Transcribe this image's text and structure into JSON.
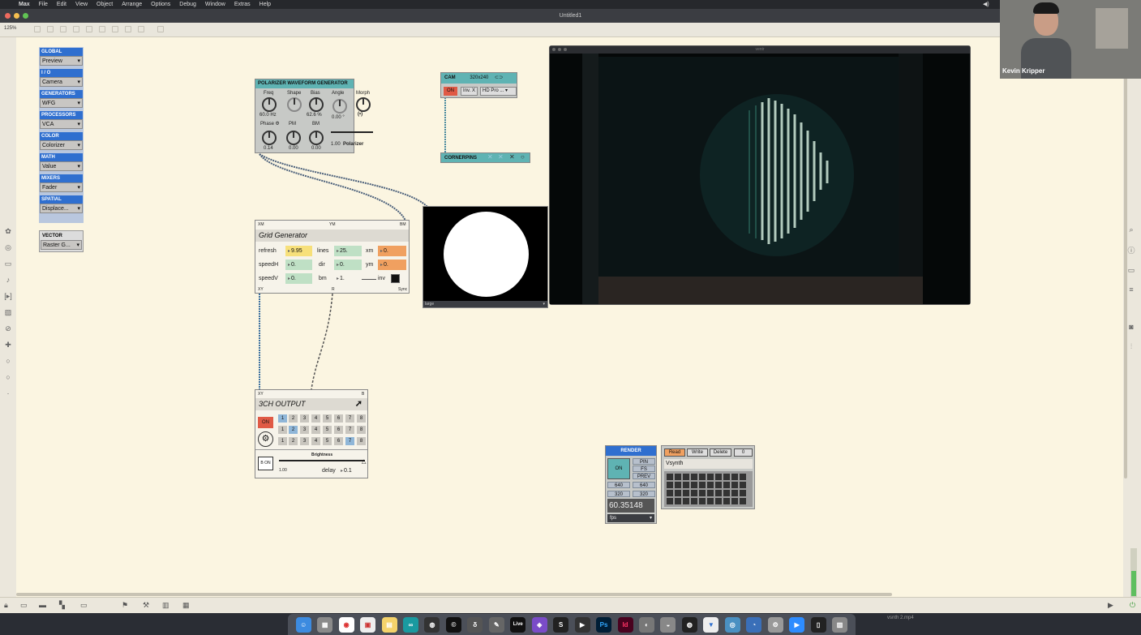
{
  "menubar": {
    "apple": "",
    "items": [
      "Max",
      "File",
      "Edit",
      "View",
      "Object",
      "Arrange",
      "Options",
      "Debug",
      "Window",
      "Extras",
      "Help"
    ]
  },
  "window": {
    "title": "Untitled1",
    "zoom": "125%"
  },
  "categories": [
    {
      "header": "GLOBAL",
      "value": "Preview"
    },
    {
      "header": "I / O",
      "value": "Camera"
    },
    {
      "header": "GENERATORS",
      "value": "WFG"
    },
    {
      "header": "PROCESSORS",
      "value": "VCA"
    },
    {
      "header": "COLOR",
      "value": "Colorizer"
    },
    {
      "header": "MATH",
      "value": "Value"
    },
    {
      "header": "MIXERS",
      "value": "Fader"
    },
    {
      "header": "SPATIAL",
      "value": "Displace..."
    }
  ],
  "vector": {
    "header": "VECTOR",
    "value": "Raster G..."
  },
  "wfg": {
    "title": "POLARIZER WAVEFORM GENERATOR",
    "freq_label": "Freq",
    "freq_value": "60.0 Hz",
    "shape_label": "Shape",
    "bias_label": "Bias",
    "bias_value": "62.6 %",
    "angle_label": "Angle",
    "angle_value": "0.00 °",
    "morph_label": "Morph",
    "morph_symbol": "(•)",
    "phase_label": "Phase Φ",
    "phase_value": "0.14",
    "pm_label": "PM",
    "pm_value": "0.00",
    "bm_label": "BM",
    "bm_value": "0.00",
    "pol_value": "1.00",
    "pol_label": "Polarizer"
  },
  "cam": {
    "title": "CAM",
    "resolution": "320x240",
    "on_label": "ON",
    "inv_label": "Inv. X",
    "device": "HD Pro ..."
  },
  "cornerpins": {
    "title": "CORNERPINS"
  },
  "grid": {
    "top_left": "XM",
    "top_mid": "YM",
    "top_right": "BM",
    "title": "Grid Generator",
    "refresh_label": "refresh",
    "refresh_value": "9.95",
    "lines_label": "lines",
    "lines_value": "25.",
    "xm_label": "xm",
    "xm_value": "0.",
    "speedh_label": "speedH",
    "speedh_value": "0.",
    "dir_label": "dir",
    "dir_value": "0.",
    "ym_label": "ym",
    "ym_value": "0.",
    "speedv_label": "speedV",
    "speedv_value": "0.",
    "bm_label": "bm",
    "bm_value": "1.",
    "inv_label": "inv",
    "out_xy": "XY",
    "out_r": "R",
    "out_sync": "Sync"
  },
  "preview": {
    "label": "large"
  },
  "viewer": {
    "title": "ventr"
  },
  "output": {
    "in_xy": "XY",
    "in_b": "B",
    "title": "3CH OUTPUT",
    "on_label": "ON",
    "row1": [
      "1",
      "2",
      "3",
      "4",
      "5",
      "6",
      "7",
      "8"
    ],
    "row2": [
      "1",
      "2",
      "3",
      "4",
      "5",
      "6",
      "7",
      "8"
    ],
    "row3": [
      "1",
      "2",
      "3",
      "4",
      "5",
      "6",
      "7",
      "8"
    ],
    "bon_label": "B ON",
    "brightness_label": "Brightness",
    "brightness_value": "1.00",
    "delay_label": "delay",
    "delay_value": "0.1"
  },
  "render": {
    "title": "RENDER",
    "on_label": "ON",
    "pin": "PIN",
    "fs": "FS",
    "prev": "PREV",
    "w1": "640",
    "w2": "640",
    "h1": "320",
    "h2": "320",
    "fps_value": "60.35148",
    "fps_label": "fps"
  },
  "preset": {
    "read": "Read",
    "write": "Write",
    "delete": "Delete",
    "count": "0",
    "name": "Vsynth"
  },
  "webcam": {
    "name": "Kevin Kripper"
  },
  "dock_filename": "vsnth 2.mp4",
  "dock_icons": [
    "Ps",
    "Id",
    "Live"
  ],
  "colors": {
    "canvas": "#fbf5e1",
    "accent_blue": "#2f6fcf",
    "teal": "#5fb3b3",
    "on_red": "#e05a45",
    "orange": "#f0a060",
    "yellow": "#f7e07a",
    "green": "#bfe0c5"
  }
}
